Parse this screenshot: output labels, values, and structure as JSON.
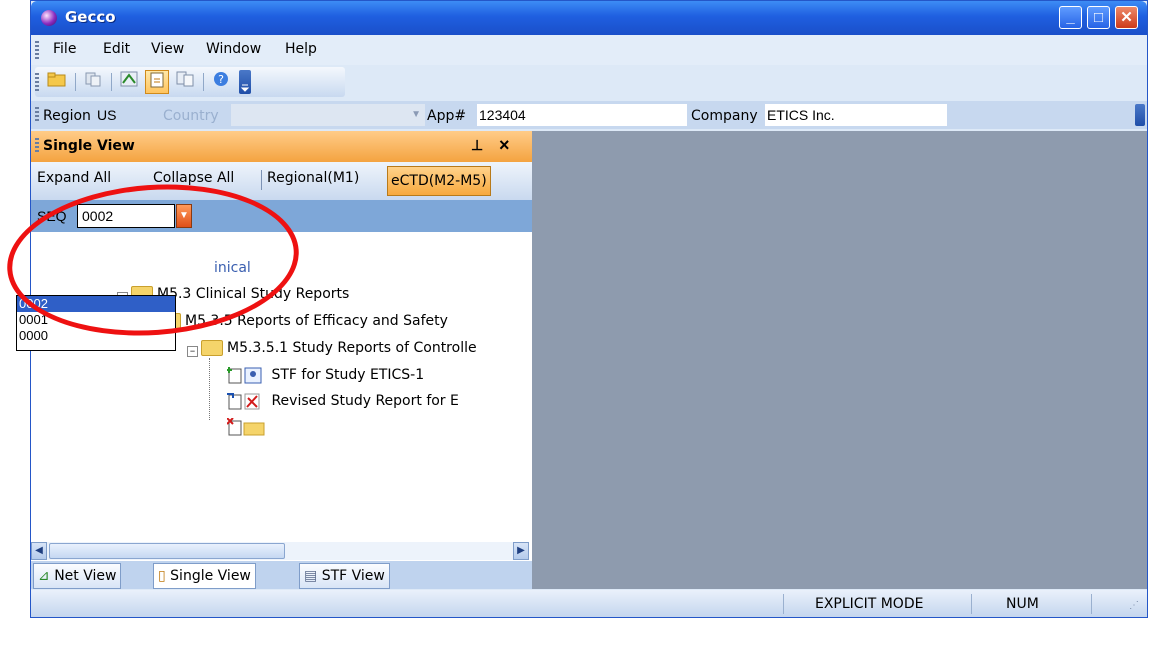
{
  "window": {
    "title": "Gecco",
    "minimize": "_",
    "maximize": "□",
    "close": "✕"
  },
  "menu": [
    "File",
    "Edit",
    "View",
    "Window",
    "Help"
  ],
  "toolbar_icons": [
    "open-folder-icon",
    "copy-icon",
    "net-view-icon",
    "single-view-icon",
    "stf-view-icon",
    "help-icon",
    "overflow-icon"
  ],
  "address": {
    "region_label": "Region",
    "region_value": "US",
    "country_label": "Country",
    "country_value": "",
    "app_label": "App#",
    "app_value": "123404",
    "company_label": "Company",
    "company_value": "ETICS Inc."
  },
  "panel": {
    "title": "Single View",
    "pin": "⊥",
    "close": "×",
    "tabs": [
      "Expand All",
      "Collapse All",
      "Regional(M1)",
      "eCTD(M2-M5)"
    ],
    "seq_label": "SEQ",
    "seq_value": "0002",
    "seq_options": [
      "0002",
      "0001",
      "0000"
    ]
  },
  "tree": {
    "partial": "inical",
    "n1": "M5.3 Clinical Study Reports",
    "n2": "M5.3.5 Reports of Efficacy and Safety",
    "n3": "M5.3.5.1 Study Reports of Controlle",
    "n4": "STF for Study ETICS-1",
    "n5": "Revised Study Report for E"
  },
  "bottom_tabs": [
    "Net View",
    "Single View",
    "STF View"
  ],
  "status": {
    "mode": "EXPLICIT MODE",
    "num": "NUM"
  },
  "colors": {
    "title_bar": "#1f5fe0",
    "panel_header": "#f4a340",
    "annotation": "#ee1111",
    "mdi_bg": "#8e9bae"
  }
}
